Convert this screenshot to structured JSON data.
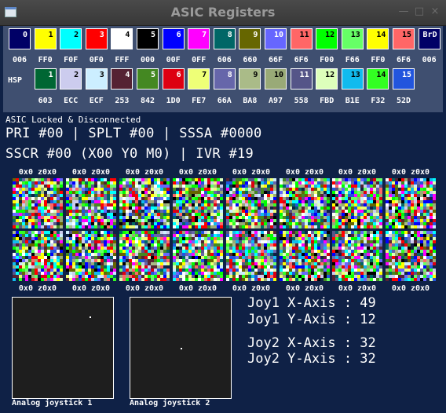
{
  "window": {
    "title": "ASIC Registers",
    "minimize": "—",
    "maximize": "□",
    "close": "×"
  },
  "palette": {
    "swatches": [
      {
        "label": "0",
        "color": "#000066",
        "hex": "006"
      },
      {
        "label": "1",
        "color": "#ffff00",
        "hex": "FF0"
      },
      {
        "label": "2",
        "color": "#00ffff",
        "hex": "F0F"
      },
      {
        "label": "3",
        "color": "#ff0000",
        "hex": "0F0"
      },
      {
        "label": "4",
        "color": "#ffffff",
        "hex": "FFF"
      },
      {
        "label": "5",
        "color": "#000000",
        "hex": "000"
      },
      {
        "label": "6",
        "color": "#0000ff",
        "hex": "00F"
      },
      {
        "label": "7",
        "color": "#ff00ff",
        "hex": "0FF"
      },
      {
        "label": "8",
        "color": "#006666",
        "hex": "606"
      },
      {
        "label": "9",
        "color": "#666600",
        "hex": "660"
      },
      {
        "label": "10",
        "color": "#6666ff",
        "hex": "66F"
      },
      {
        "label": "11",
        "color": "#ff6666",
        "hex": "6F6"
      },
      {
        "label": "12",
        "color": "#00ff00",
        "hex": "F00"
      },
      {
        "label": "13",
        "color": "#66ff66",
        "hex": "F66"
      },
      {
        "label": "14",
        "color": "#ffff00",
        "hex": "FF0"
      },
      {
        "label": "15",
        "color": "#ff6666",
        "hex": "6F6"
      },
      {
        "label": "BrD",
        "color": "#000066",
        "hex": "006"
      }
    ],
    "hsp_label": "HSP",
    "hsp": [
      {
        "label": "1",
        "color": "#006633",
        "hex": "603"
      },
      {
        "label": "2",
        "color": "#ccccee",
        "hex": "ECC"
      },
      {
        "label": "3",
        "color": "#cceeff",
        "hex": "ECF"
      },
      {
        "label": "4",
        "color": "#552233",
        "hex": "253"
      },
      {
        "label": "5",
        "color": "#448822",
        "hex": "842"
      },
      {
        "label": "6",
        "color": "#dd0011",
        "hex": "1D0"
      },
      {
        "label": "7",
        "color": "#eeff77",
        "hex": "FE7"
      },
      {
        "label": "8",
        "color": "#6666aa",
        "hex": "66A"
      },
      {
        "label": "9",
        "color": "#aabb88",
        "hex": "BA8"
      },
      {
        "label": "10",
        "color": "#99aa77",
        "hex": "A97"
      },
      {
        "label": "11",
        "color": "#555588",
        "hex": "558"
      },
      {
        "label": "12",
        "color": "#ddffbb",
        "hex": "FBD"
      },
      {
        "label": "13",
        "color": "#11bbee",
        "hex": "B1E"
      },
      {
        "label": "14",
        "color": "#33ff22",
        "hex": "F32"
      },
      {
        "label": "15",
        "color": "#2255dd",
        "hex": "52D"
      }
    ]
  },
  "status": "ASIC Locked & Disconnected",
  "registers": {
    "line1": "PRI #00 | SPLT #00 | SSSA #0000",
    "line2": "SSCR #00 (X00 Y0 M0) | IVR #19"
  },
  "sprites": {
    "top_labels": [
      "0x0 z0x0",
      "0x0 z0x0",
      "0x0 z0x0",
      "0x0 z0x0",
      "0x0 z0x0",
      "0x0 z0x0",
      "0x0 z0x0",
      "0x0 z0x0"
    ],
    "bottom_labels": [
      "0x0 z0x0",
      "0x0 z0x0",
      "0x0 z0x0",
      "0x0 z0x0",
      "0x0 z0x0",
      "0x0 z0x0",
      "0x0 z0x0",
      "0x0 z0x0"
    ]
  },
  "joysticks": {
    "joy1": {
      "label": "Analog joystick 1",
      "x": 49,
      "y": 12
    },
    "joy2": {
      "label": "Analog joystick 2",
      "x": 32,
      "y": 32
    },
    "lines": [
      "Joy1 X-Axis : 49",
      "Joy1 Y-Axis : 12",
      "Joy2 X-Axis : 32",
      "Joy2 Y-Axis : 32"
    ]
  }
}
